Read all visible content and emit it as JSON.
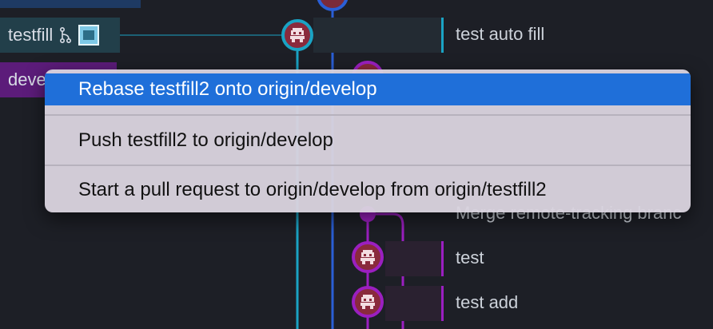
{
  "branches": {
    "testfill": {
      "label": "testfill",
      "color": "#223f4a"
    },
    "develop": {
      "label": "deve",
      "color": "#5c1c7a"
    }
  },
  "commits": [
    {
      "message": "test auto fill",
      "branch": "testfill",
      "avatar_ring": "#1aa3c4"
    },
    {
      "message": "Merge remote-tracking branc",
      "branch": "develop",
      "avatar_ring": "#9b1fc0"
    },
    {
      "message": "test",
      "branch": "develop",
      "avatar_ring": "#9b1fc0"
    },
    {
      "message": "test add",
      "branch": "develop",
      "avatar_ring": "#9b1fc0"
    }
  ],
  "colors": {
    "background": "#1d1f26",
    "teal_line": "#1aa3c4",
    "blue_line": "#2a5fd6",
    "purple_line": "#9b1fc0",
    "menu_highlight": "#1f6fd9"
  },
  "context_menu": {
    "items": [
      {
        "label": "Rebase testfill2 onto origin/develop",
        "selected": true
      },
      {
        "label": "Push testfill2 to origin/develop",
        "selected": false
      },
      {
        "label": "Start a pull request to origin/develop from origin/testfill2",
        "selected": false
      }
    ]
  },
  "icons": {
    "branch_icon": "git-branch-icon",
    "save_icon": "floppy-disk-icon"
  }
}
